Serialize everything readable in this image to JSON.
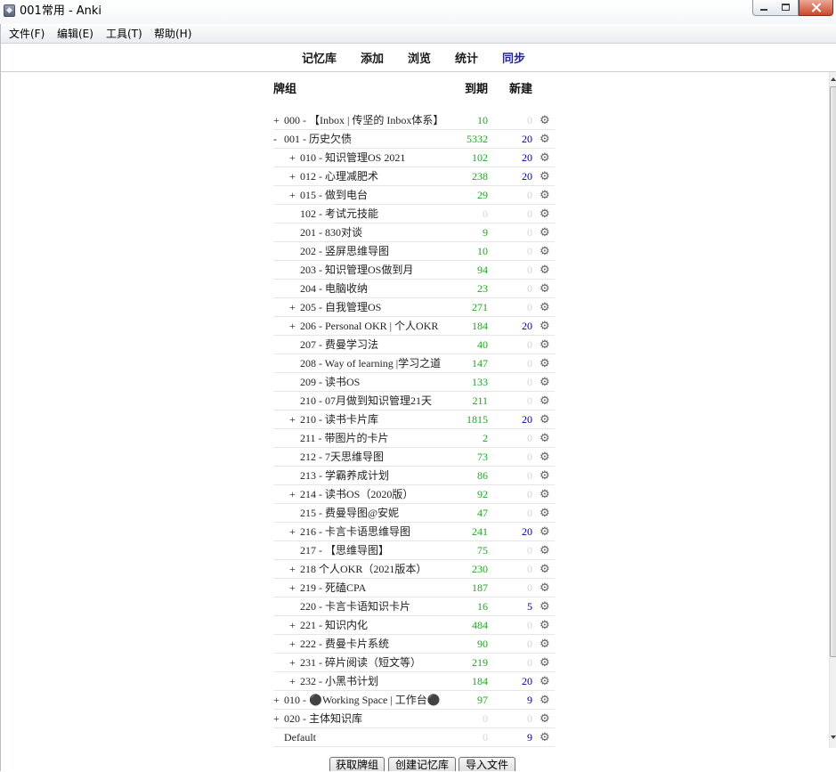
{
  "window": {
    "title": "001常用 - Anki",
    "icon": "anki-icon",
    "controls": {
      "minimize": "minimize-icon",
      "maximize": "maximize-icon",
      "close": "close-icon"
    }
  },
  "menu": {
    "items": [
      {
        "label": "文件(F)"
      },
      {
        "label": "编辑(E)"
      },
      {
        "label": "工具(T)"
      },
      {
        "label": "帮助(H)"
      }
    ]
  },
  "toolbar": {
    "items": [
      {
        "label": "记忆库"
      },
      {
        "label": "添加"
      },
      {
        "label": "浏览"
      },
      {
        "label": "统计"
      },
      {
        "label": "同步"
      }
    ]
  },
  "deck_list": {
    "headers": {
      "deck": "牌组",
      "due": "到期",
      "new": "新建"
    },
    "options_icon": "gear-icon",
    "rows": [
      {
        "level": 0,
        "collapse": "+",
        "name": "000 - 【Inbox | 传坚的 Inbox体系】",
        "due": 10,
        "new": 0
      },
      {
        "level": 0,
        "collapse": "-",
        "name": "001 - 历史欠债",
        "due": 5332,
        "new": 20
      },
      {
        "level": 1,
        "collapse": "+",
        "name": "010 - 知识管理OS 2021",
        "due": 102,
        "new": 20
      },
      {
        "level": 1,
        "collapse": "+",
        "name": "012 - 心理减肥术",
        "due": 238,
        "new": 20
      },
      {
        "level": 1,
        "collapse": "+",
        "name": "015 - 做到电台",
        "due": 29,
        "new": 0
      },
      {
        "level": 1,
        "name": "102 - 考试元技能",
        "due": 0,
        "new": 0
      },
      {
        "level": 1,
        "name": "201 - 830对谈",
        "due": 9,
        "new": 0
      },
      {
        "level": 1,
        "name": "202 - 竖屏思维导图",
        "due": 10,
        "new": 0
      },
      {
        "level": 1,
        "name": "203 - 知识管理OS做到月",
        "due": 94,
        "new": 0
      },
      {
        "level": 1,
        "name": "204 - 电脑收纳",
        "due": 23,
        "new": 0
      },
      {
        "level": 1,
        "collapse": "+",
        "name": "205 - 自我管理OS",
        "due": 271,
        "new": 0
      },
      {
        "level": 1,
        "collapse": "+",
        "name": "206 - Personal OKR | 个人OKR",
        "due": 184,
        "new": 20
      },
      {
        "level": 1,
        "name": "207 - 费曼学习法",
        "due": 40,
        "new": 0
      },
      {
        "level": 1,
        "name": "208 - Way of learning |学习之道",
        "due": 147,
        "new": 0
      },
      {
        "level": 1,
        "name": "209 - 读书OS",
        "due": 133,
        "new": 0
      },
      {
        "level": 1,
        "name": "210 - 07月做到知识管理21天",
        "due": 211,
        "new": 0
      },
      {
        "level": 1,
        "collapse": "+",
        "name": "210 - 读书卡片库",
        "due": 1815,
        "new": 20
      },
      {
        "level": 1,
        "name": "211 - 带图片的卡片",
        "due": 2,
        "new": 0
      },
      {
        "level": 1,
        "name": "212 - 7天思维导图",
        "due": 73,
        "new": 0
      },
      {
        "level": 1,
        "name": "213 - 学霸养成计划",
        "due": 86,
        "new": 0
      },
      {
        "level": 1,
        "collapse": "+",
        "name": "214 - 读书OS（2020版）",
        "due": 92,
        "new": 0
      },
      {
        "level": 1,
        "name": "215 - 费曼导图@安妮",
        "due": 47,
        "new": 0
      },
      {
        "level": 1,
        "collapse": "+",
        "name": "216 - 卡言卡语思维导图",
        "due": 241,
        "new": 20
      },
      {
        "level": 1,
        "name": "217 - 【思维导图】",
        "due": 75,
        "new": 0
      },
      {
        "level": 1,
        "collapse": "+",
        "name": "218 个人OKR（2021版本）",
        "due": 230,
        "new": 0
      },
      {
        "level": 1,
        "collapse": "+",
        "name": "219 - 死磕CPA",
        "due": 187,
        "new": 0
      },
      {
        "level": 1,
        "name": "220 - 卡言卡语知识卡片",
        "due": 16,
        "new": 5
      },
      {
        "level": 1,
        "collapse": "+",
        "name": "221 - 知识内化",
        "due": 484,
        "new": 0
      },
      {
        "level": 1,
        "collapse": "+",
        "name": "222 - 费曼卡片系统",
        "due": 90,
        "new": 0
      },
      {
        "level": 1,
        "collapse": "+",
        "name": "231 - 碎片阅读（短文等）",
        "due": 219,
        "new": 0
      },
      {
        "level": 1,
        "collapse": "+",
        "name": "232 - 小黑书计划",
        "due": 184,
        "new": 20
      },
      {
        "level": 0,
        "collapse": "+",
        "name": "010 - ⚫Working Space | 工作台⚫",
        "due": 97,
        "new": 9
      },
      {
        "level": 0,
        "collapse": "+",
        "name": "020 - 主体知识库",
        "due": 0,
        "new": 0
      },
      {
        "level": 0,
        "name": "Default",
        "due": 0,
        "new": 9
      }
    ]
  },
  "bottom_bar": {
    "buttons": [
      {
        "label": "获取牌组"
      },
      {
        "label": "创建记忆库"
      },
      {
        "label": "导入文件"
      }
    ]
  },
  "colors": {
    "due_count": "#22a322",
    "new_count": "#000090",
    "zero_count": "#d4d4d4",
    "sync_highlight": "#24249c",
    "close_button": "#c9482b"
  }
}
